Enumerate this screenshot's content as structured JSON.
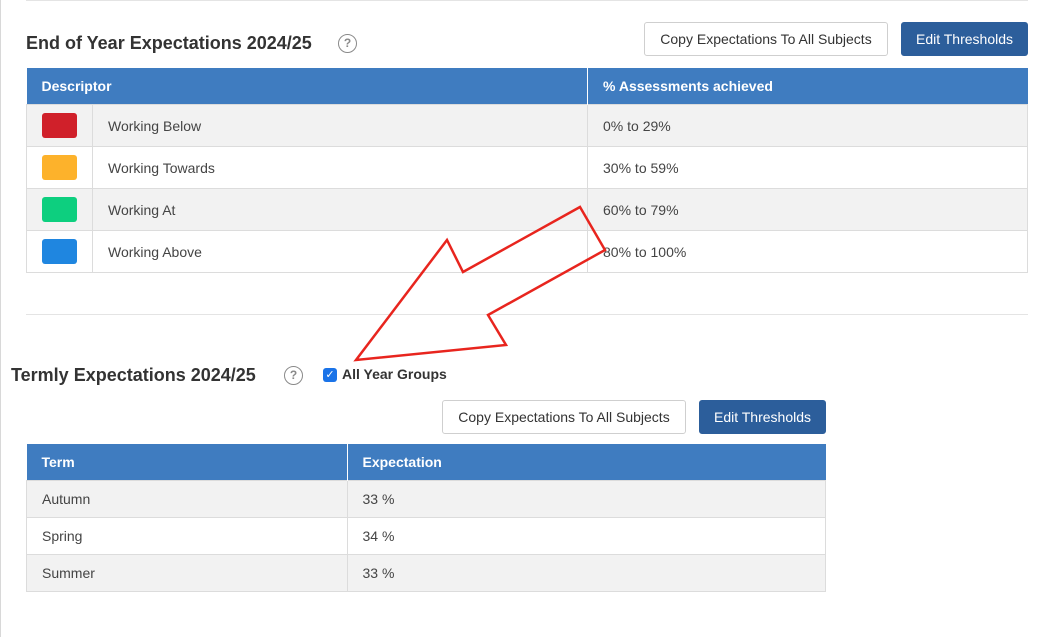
{
  "end_of_year": {
    "title": "End of Year Expectations 2024/25",
    "help_glyph": "?",
    "copy_button": "Copy Expectations To All Subjects",
    "edit_button": "Edit Thresholds",
    "columns": [
      "Descriptor",
      "% Assessments achieved"
    ],
    "rows": [
      {
        "color": "#d0202a",
        "descriptor": "Working Below",
        "range": "0% to 29%"
      },
      {
        "color": "#fdb22b",
        "descriptor": "Working Towards",
        "range": "30% to 59%"
      },
      {
        "color": "#0dcf7f",
        "descriptor": "Working At",
        "range": "60% to 79%"
      },
      {
        "color": "#1f86e0",
        "descriptor": "Working Above",
        "range": "80% to 100%"
      }
    ]
  },
  "termly": {
    "title": "Termly Expectations 2024/25",
    "help_glyph": "?",
    "checkbox_label": "All Year Groups",
    "checkbox_checked": true,
    "checkbox_glyph": "✓",
    "copy_button": "Copy Expectations To All Subjects",
    "edit_button": "Edit Thresholds",
    "columns": [
      "Term",
      "Expectation"
    ],
    "rows": [
      {
        "term": "Autumn",
        "expectation": "33 %"
      },
      {
        "term": "Spring",
        "expectation": "34 %"
      },
      {
        "term": "Summer",
        "expectation": "33 %"
      }
    ]
  },
  "colors": {
    "header": "#3f7cc0",
    "primary_button": "#2c5e9b",
    "annotation_arrow": "#e8251e"
  }
}
